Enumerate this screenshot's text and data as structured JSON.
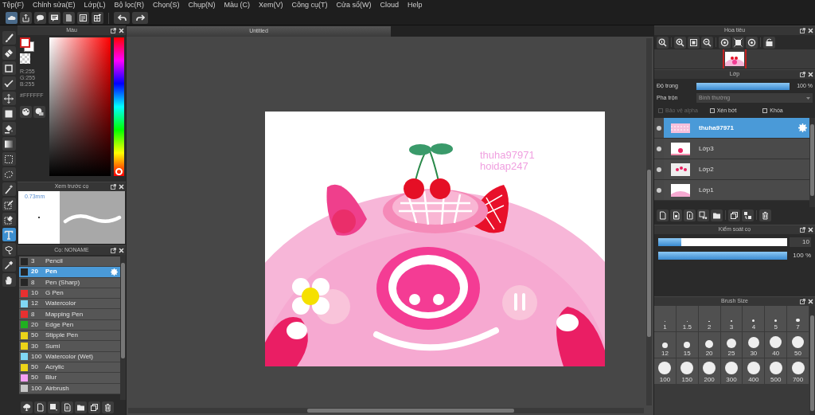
{
  "menu": [
    "Tệp(F)",
    "Chỉnh sửa(E)",
    "Lớp(L)",
    "Bộ lọc(R)",
    "Chọn(S)",
    "Chụp(N)",
    "Màu (C)",
    "Xem(V)",
    "Công cụ(T)",
    "Cửa sổ(W)",
    "Cloud",
    "Help"
  ],
  "tools": [
    {
      "selected": false
    },
    {
      "selected": false
    },
    {
      "selected": false
    },
    {
      "selected": false
    },
    {
      "selected": false
    },
    {
      "selected": false
    },
    {
      "selected": false
    },
    {
      "selected": false
    },
    {
      "selected": false
    },
    {
      "selected": false
    },
    {
      "selected": false
    },
    {
      "selected": false
    },
    {
      "selected": false
    },
    {
      "selected": true
    },
    {
      "selected": false
    },
    {
      "selected": false
    },
    {
      "selected": false
    }
  ],
  "color_panel": {
    "title": "Màu",
    "r": "R:255",
    "g": "G:255",
    "b": "B:255",
    "hex": "#FFFFFF"
  },
  "brush_preview": {
    "title": "Xem trước cọ",
    "size": "0.73mm"
  },
  "brush_panel": {
    "title": "Cọ: NONAME",
    "brushes": [
      {
        "size": "3",
        "name": "Pencil",
        "color": "#262626",
        "selected": false
      },
      {
        "size": "20",
        "name": "Pen",
        "color": "#262626",
        "selected": true
      },
      {
        "size": "8",
        "name": "Pen (Sharp)",
        "color": "#262626",
        "selected": false
      },
      {
        "size": "10",
        "name": "G Pen",
        "color": "#e83030",
        "selected": false
      },
      {
        "size": "12",
        "name": "Watercolor",
        "color": "#80d8f4",
        "selected": false
      },
      {
        "size": "8",
        "name": "Mapping Pen",
        "color": "#e83030",
        "selected": false
      },
      {
        "size": "20",
        "name": "Edge Pen",
        "color": "#20b020",
        "selected": false
      },
      {
        "size": "50",
        "name": "Stipple Pen",
        "color": "#ecd418",
        "selected": false
      },
      {
        "size": "30",
        "name": "Sumi",
        "color": "#ecd418",
        "selected": false
      },
      {
        "size": "100",
        "name": "Watercolor (Wet)",
        "color": "#80d8f4",
        "selected": false
      },
      {
        "size": "50",
        "name": "Acrylic",
        "color": "#ecd418",
        "selected": false
      },
      {
        "size": "50",
        "name": "Blur",
        "color": "#f4a0f4",
        "selected": false
      },
      {
        "size": "100",
        "name": "Airbrush",
        "color": "#c8c8c8",
        "selected": false
      }
    ]
  },
  "document": {
    "tab": "Untitled",
    "canvas_text": [
      "thuha97971",
      "hoidap247"
    ]
  },
  "navigator": {
    "title": "Hoa tiêu"
  },
  "layers_panel": {
    "title": "Lớp",
    "opacity_label": "Độ trong",
    "opacity": {
      "level": 1,
      "reading": "100 %"
    },
    "blend_label": "Pha trộn",
    "blend_value": "Bình thường",
    "options": [
      {
        "label": "Bảo vệ alpha",
        "checked": false,
        "disabled": true
      },
      {
        "label": "Xén bớt",
        "checked": false,
        "disabled": false
      },
      {
        "label": "Khóa",
        "checked": false,
        "disabled": false
      }
    ],
    "layers": [
      {
        "name": "thuha97971",
        "selected": true
      },
      {
        "name": "Lớp3",
        "selected": false
      },
      {
        "name": "Lớp2",
        "selected": false
      },
      {
        "name": "Lớp1",
        "selected": false
      }
    ]
  },
  "brush_control": {
    "title": "Kiểm soát cọ",
    "size": {
      "level": 0.18,
      "reading": "10"
    },
    "opacity": {
      "level": 1,
      "reading": "100 %"
    }
  },
  "brush_size": {
    "title": "Brush Size",
    "sizes": [
      "1",
      "1.5",
      "2",
      "3",
      "4",
      "5",
      "7",
      "12",
      "15",
      "20",
      "25",
      "30",
      "40",
      "50",
      "100",
      "150",
      "200",
      "300",
      "400",
      "500",
      "700"
    ]
  }
}
